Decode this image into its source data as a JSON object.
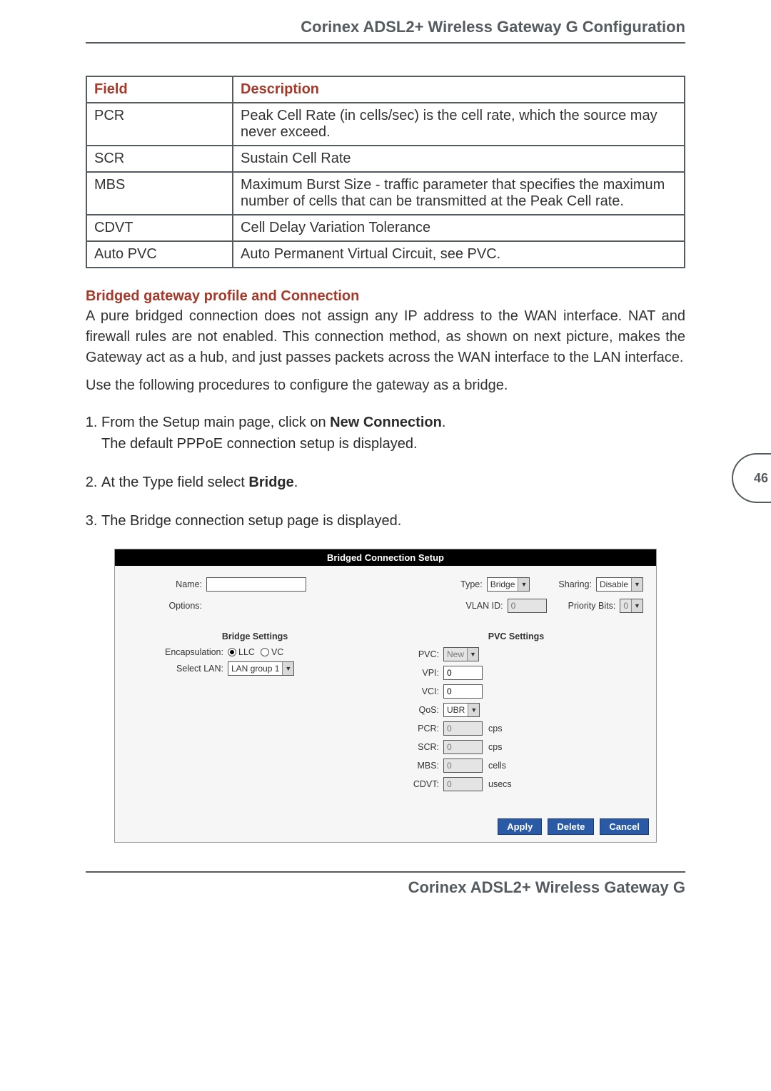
{
  "header_title": "Corinex ADSL2+ Wireless Gateway G Configuration",
  "footer_title": "Corinex ADSL2+ Wireless Gateway G",
  "page_number": "46",
  "defs_table": {
    "headers": [
      "Field",
      "Description"
    ],
    "rows": [
      [
        "PCR",
        "Peak Cell Rate (in cells/sec) is the cell rate, which the source may never exceed."
      ],
      [
        "SCR",
        "Sustain Cell Rate"
      ],
      [
        "MBS",
        "Maximum Burst Size - traffic parameter that specifies the maximum number of cells that can be transmitted at the Peak Cell rate."
      ],
      [
        "CDVT",
        "Cell Delay Variation Tolerance"
      ],
      [
        "Auto PVC",
        "Auto Permanent Virtual Circuit, see PVC."
      ]
    ]
  },
  "section_heading": "Bridged gateway profile and Connection",
  "section_para1": "A pure bridged connection does not assign any IP address to the WAN interface. NAT and firewall rules are not enabled. This connection method, as shown on next picture, makes the Gateway act as a hub, and just passes packets across the WAN interface to the LAN interface.",
  "section_para2": "Use the following procedures to configure the gateway as a bridge.",
  "procedure": [
    {
      "pre": "From the Setup main page, click on ",
      "bold": "New Connection",
      "post": ".\nThe default PPPoE connection setup is displayed."
    },
    {
      "pre": "At the Type field select ",
      "bold": "Bridge",
      "post": "."
    },
    {
      "pre": "The Bridge connection setup page is displayed.",
      "bold": "",
      "post": ""
    }
  ],
  "ui": {
    "title": "Bridged Connection Setup",
    "row1": {
      "name_label": "Name:",
      "name_value": "",
      "type_label": "Type:",
      "type_value": "Bridge",
      "sharing_label": "Sharing:",
      "sharing_value": "Disable"
    },
    "row2": {
      "options_label": "Options:",
      "vlan_label": "VLAN ID:",
      "vlan_value": "0",
      "priority_label": "Priority Bits:",
      "priority_value": "0"
    },
    "bridge": {
      "title": "Bridge Settings",
      "encaps_label": "Encapsulation:",
      "encaps_llc": "LLC",
      "encaps_vc": "VC",
      "selectlan_label": "Select LAN:",
      "selectlan_value": "LAN group 1"
    },
    "pvc": {
      "title": "PVC Settings",
      "pvc_label": "PVC:",
      "pvc_value": "New",
      "vpi_label": "VPI:",
      "vpi_value": "0",
      "vci_label": "VCI:",
      "vci_value": "0",
      "qos_label": "QoS:",
      "qos_value": "UBR",
      "pcr_label": "PCR:",
      "pcr_value": "0",
      "pcr_unit": "cps",
      "scr_label": "SCR:",
      "scr_value": "0",
      "scr_unit": "cps",
      "mbs_label": "MBS:",
      "mbs_value": "0",
      "mbs_unit": "cells",
      "cdvt_label": "CDVT:",
      "cdvt_value": "0",
      "cdvt_unit": "usecs"
    },
    "buttons": {
      "apply": "Apply",
      "delete": "Delete",
      "cancel": "Cancel"
    }
  }
}
